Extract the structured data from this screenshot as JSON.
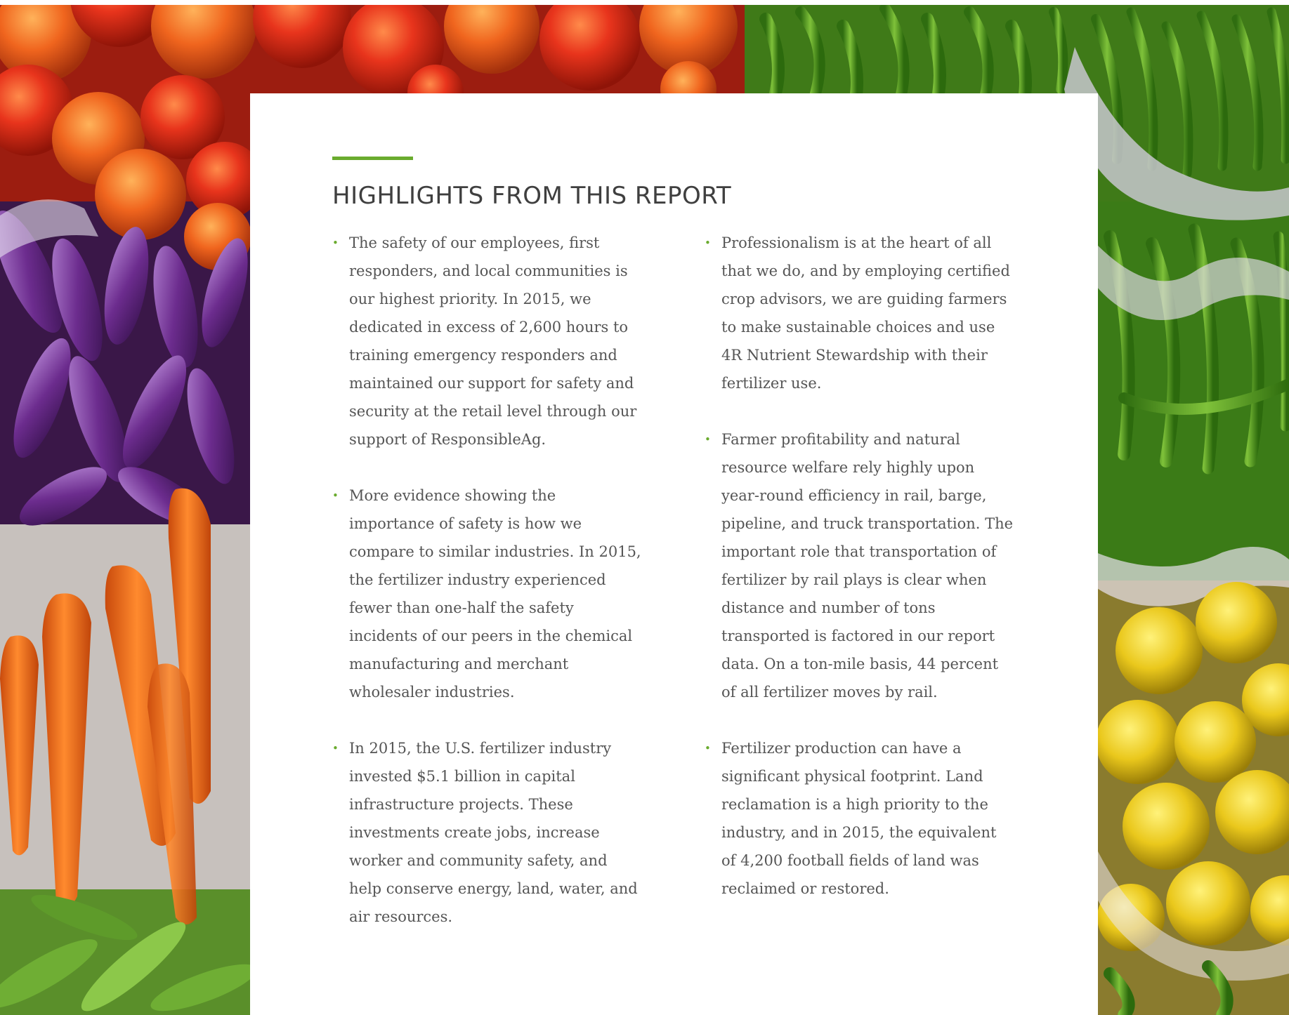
{
  "report": {
    "heading": "HIGHLIGHTS FROM THIS REPORT",
    "accent_color": "#6aab2e",
    "left_column": [
      "The safety of our employees, first responders, and local communities is our highest priority. In 2015, we dedicated in excess of 2,600 hours to training emergency responders and maintained our support for safety and security at the retail level through our support of ResponsibleAg.",
      "More evidence showing the importance of safety is how we compare to similar industries. In 2015, the fertilizer industry experienced fewer than one-half the safety incidents of our peers in the chemical manufacturing and merchant wholesaler industries.",
      "In 2015, the U.S. fertilizer industry invested $5.1 billion in capital infrastructure projects. These investments create jobs, increase worker and community safety, and help conserve energy, land, water, and air resources."
    ],
    "right_column": [
      "Professionalism is at the heart of all that we do, and by employing certified crop advisors, we are guiding farmers to make sustainable choices and use 4R Nutrient Stewardship with their fertilizer use.",
      "Farmer profitability and natural resource welfare rely highly upon year-round efficiency in rail, barge, pipeline, and truck transportation. The important role that transportation of fertilizer by rail plays is clear when distance and number of tons transported is factored in our report data. On a ton-mile basis, 44 percent of all fertilizer moves by rail.",
      "Fertilizer production can have a significant physical footprint. Land reclamation is a high priority to the industry, and in 2015, the equivalent of 4,200 football fields of land was reclaimed or restored."
    ],
    "bullet_glyph": "•"
  }
}
